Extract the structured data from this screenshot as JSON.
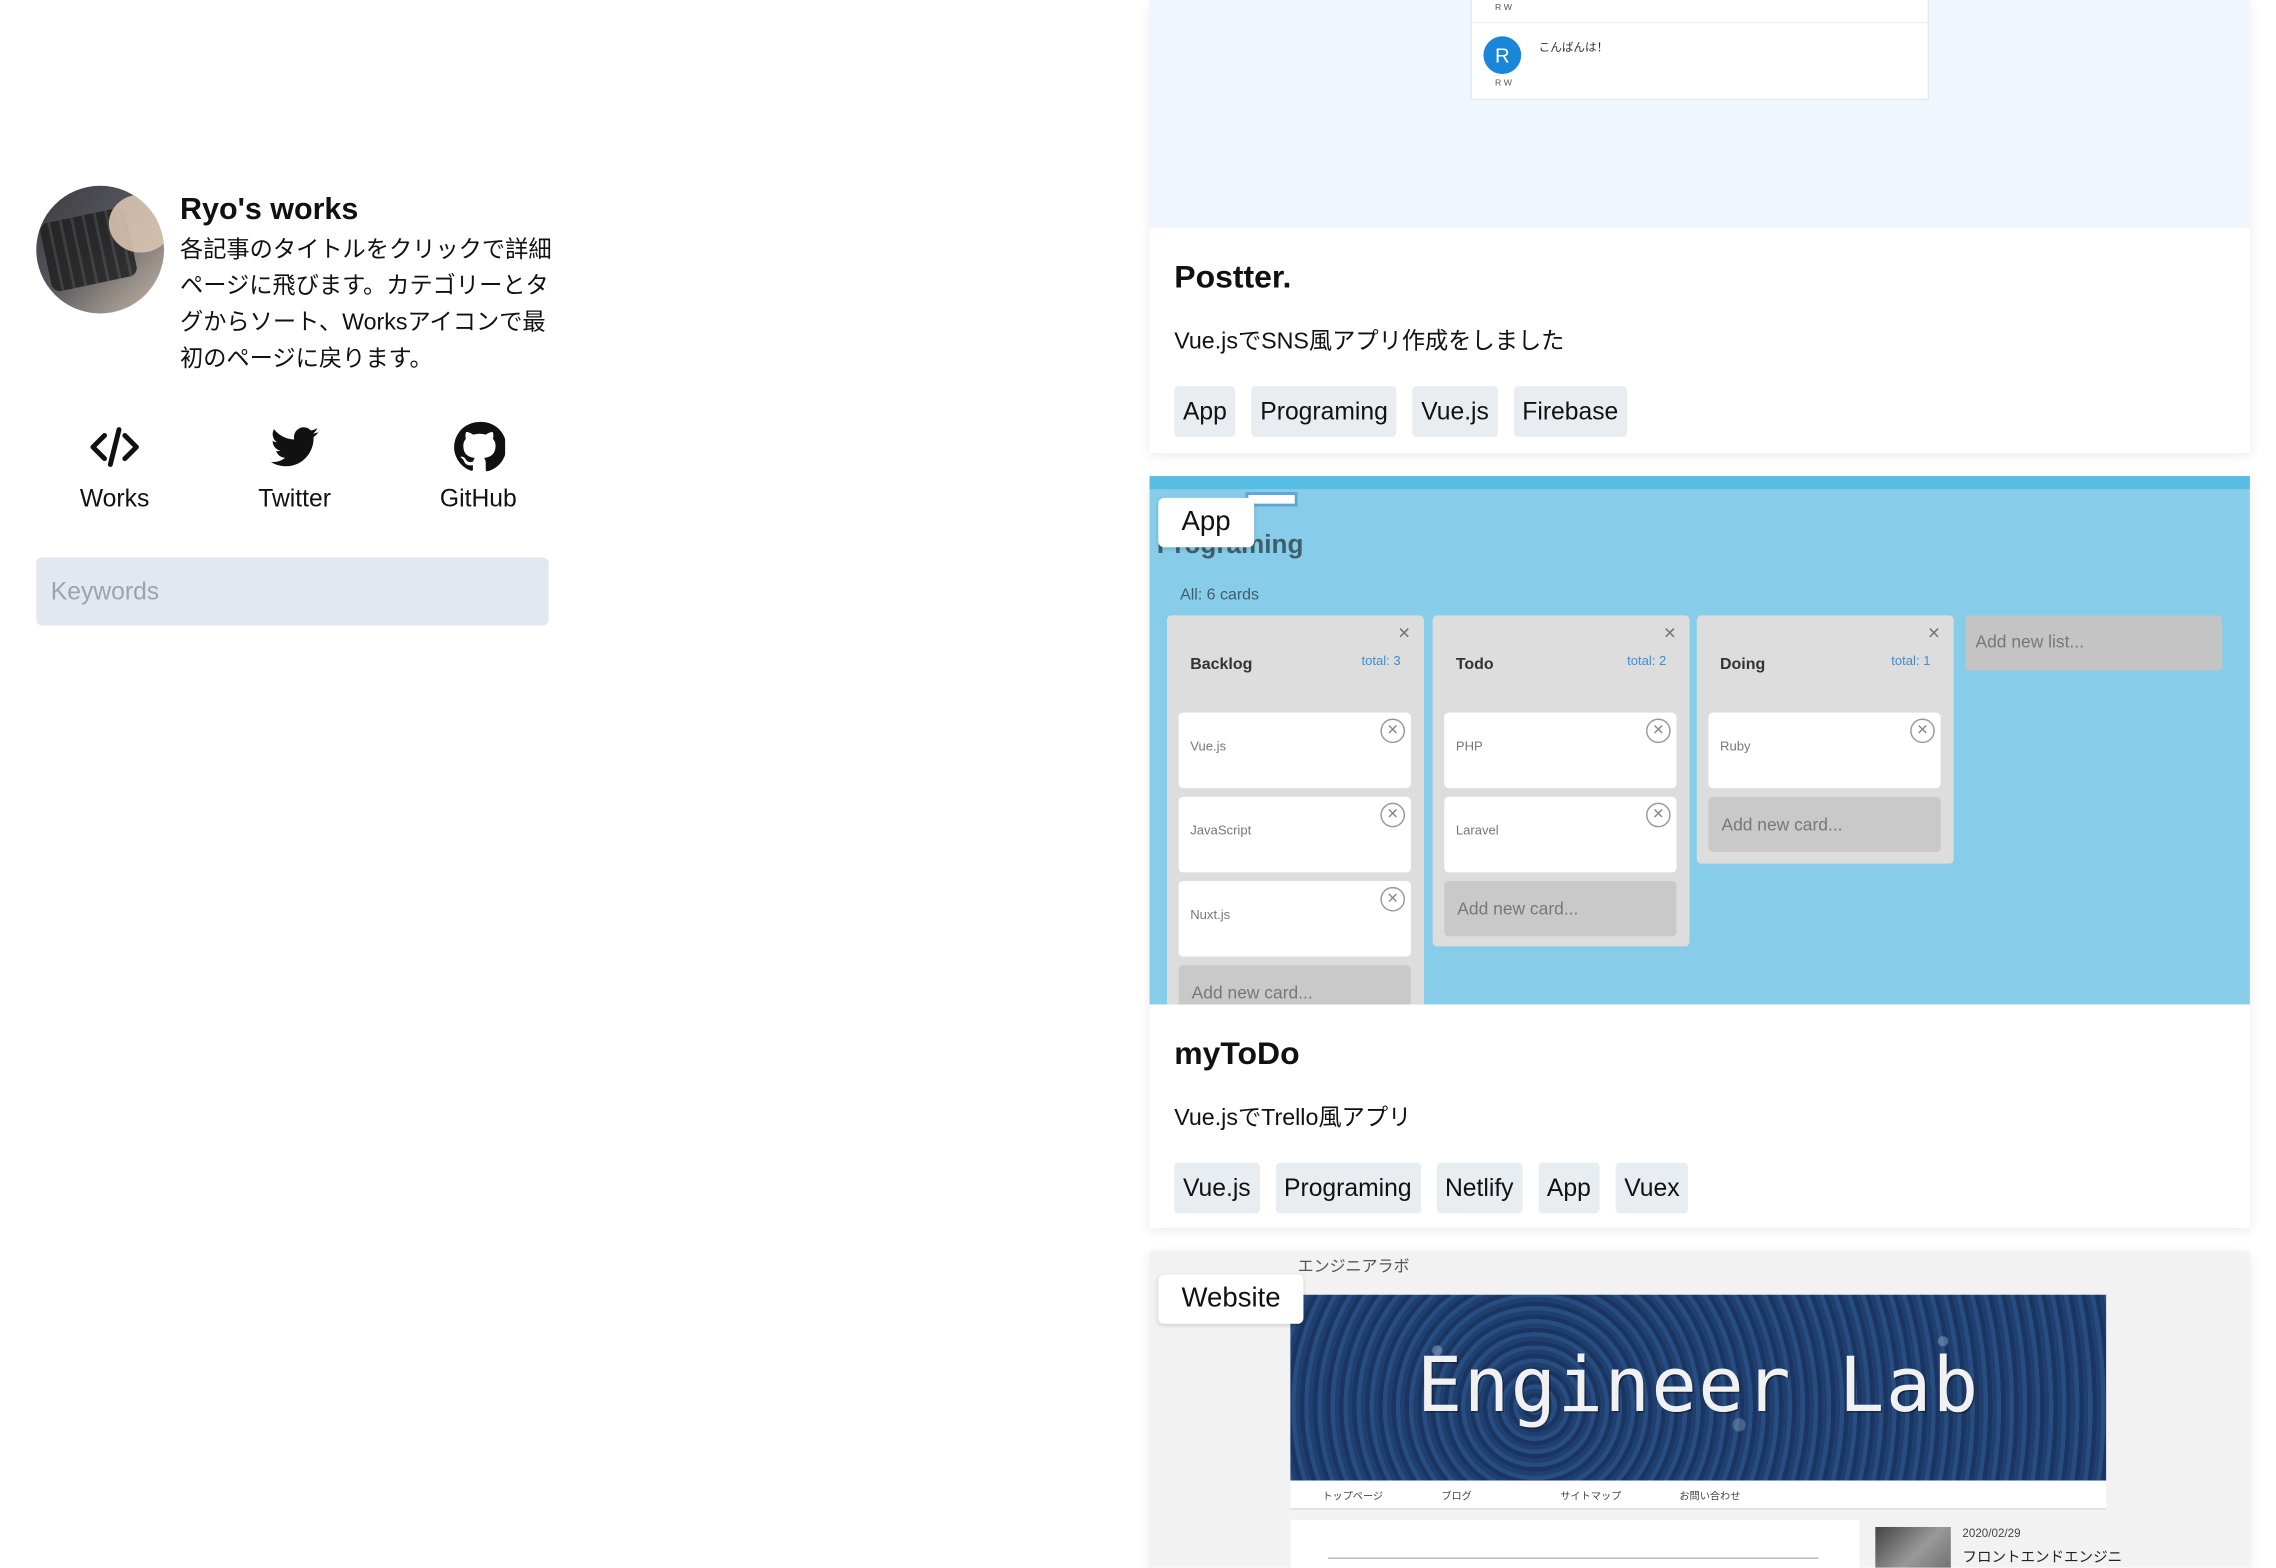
{
  "sidebar": {
    "title": "Ryo's works",
    "description": "各記事のタイトルをクリックで詳細ページに飛びます。カテゴリーとタグからソート、Worksアイコンで最初のページに戻ります。",
    "socials": [
      {
        "label": "Works",
        "icon": "code-icon"
      },
      {
        "label": "Twitter",
        "icon": "twitter-bird-icon"
      },
      {
        "label": "GitHub",
        "icon": "github-octocat-icon"
      }
    ],
    "search": {
      "placeholder": "Keywords",
      "value": ""
    }
  },
  "cards": [
    {
      "title": "Postter.",
      "description": "Vue.jsでSNS風アプリ作成をしました",
      "tags": [
        "App",
        "Programing",
        "Vue.js",
        "Firebase"
      ],
      "thumb": {
        "rw_top": "R W",
        "avatar_letter": "R",
        "rw_bottom": "R W",
        "greeting": "こんばんは！"
      }
    },
    {
      "category": "App",
      "title": "myToDo",
      "description": "Vue.jsでTrello風アプリ",
      "tags": [
        "Vue.js",
        "Programing",
        "Netlify",
        "App",
        "Vuex"
      ],
      "thumb": {
        "project_title": "Programing",
        "count": "All: 6 cards",
        "lists": [
          {
            "name": "Backlog",
            "total": "total: 3",
            "cards": [
              "Vue.js",
              "JavaScript",
              "Nuxt.js"
            ],
            "add": "Add new card..."
          },
          {
            "name": "Todo",
            "total": "total: 2",
            "cards": [
              "PHP",
              "Laravel"
            ],
            "add": "Add new card..."
          },
          {
            "name": "Doing",
            "total": "total: 1",
            "cards": [
              "Ruby"
            ],
            "add": "Add new card..."
          }
        ],
        "add_list": "Add new list..."
      }
    },
    {
      "category": "Website",
      "thumb": {
        "top_text": "エンジニアラボ",
        "banner_text": "Engineer Lab",
        "nav": [
          "トップページ",
          "ブログ",
          "サイトマップ",
          "お問い合わせ"
        ],
        "date": "2020/02/29",
        "side_title": "フロントエンドエンジニ"
      }
    }
  ],
  "colors": {
    "tag_bg": "#e8edf2",
    "search_bg": "#e3e8f0",
    "todo_bg": "#87cce8",
    "banner_bg": "#1f3f6e"
  }
}
